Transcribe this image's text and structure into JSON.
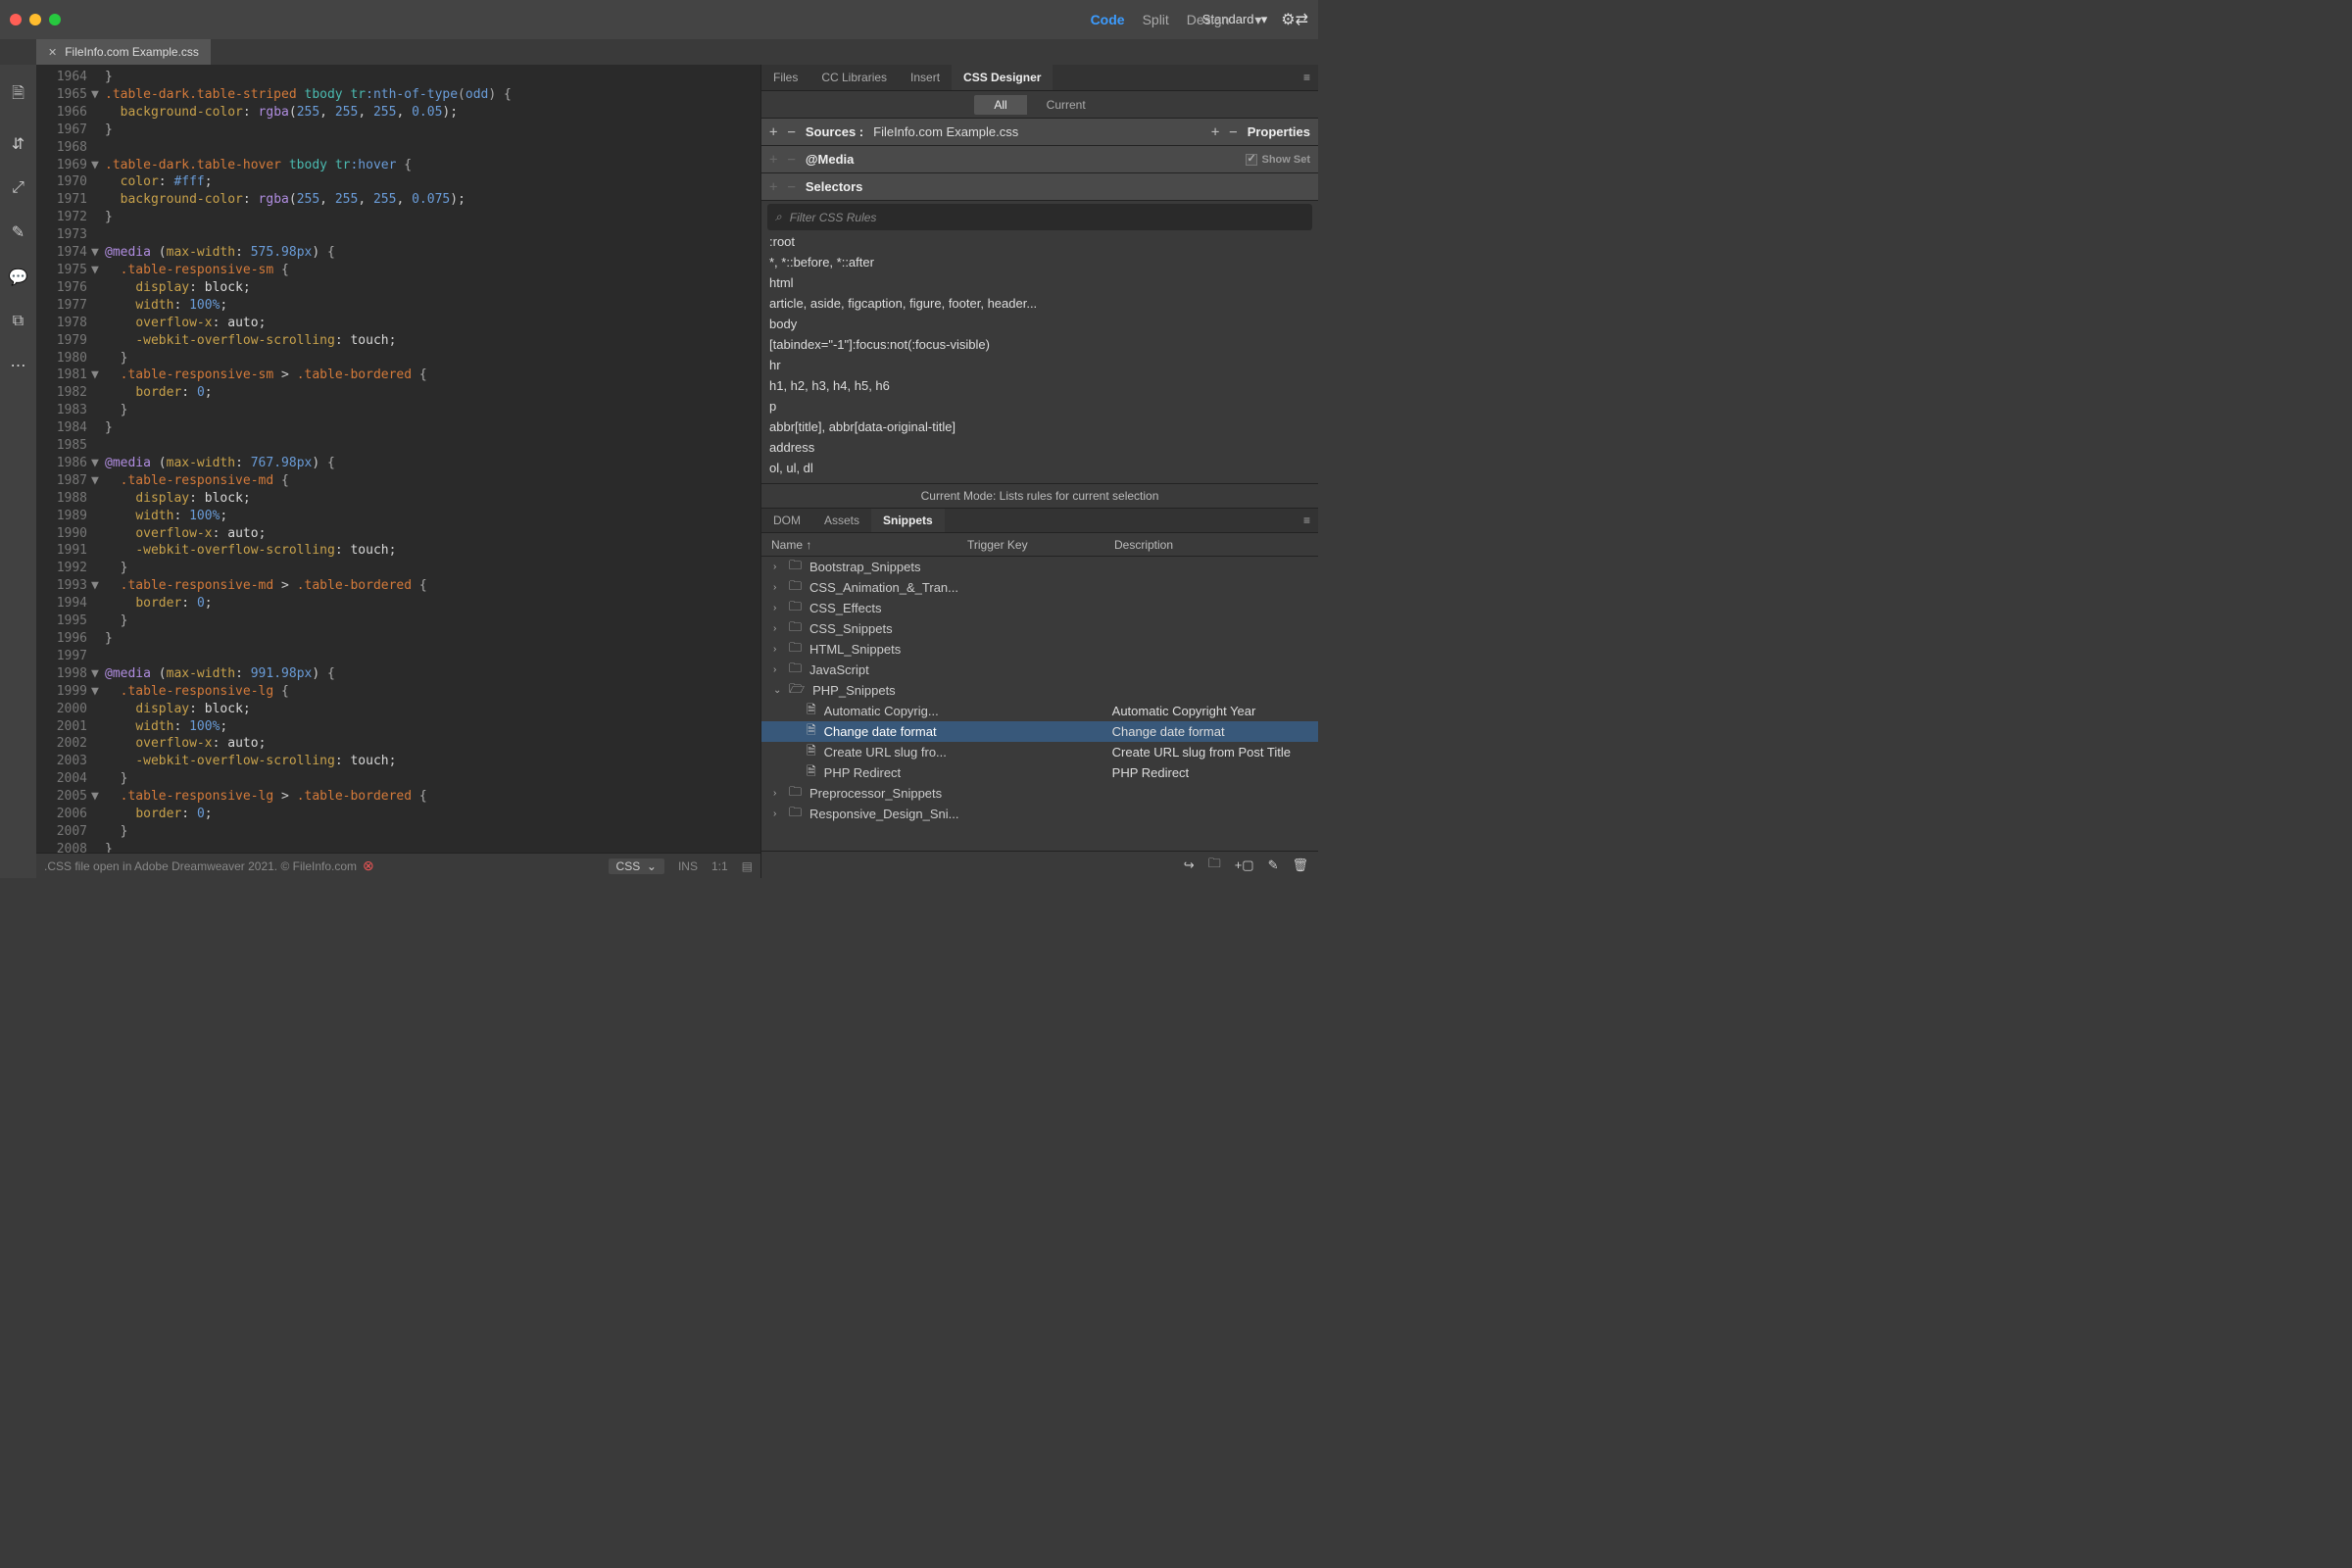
{
  "topTabs": {
    "code": "Code",
    "split": "Split",
    "design": "Design"
  },
  "workspace": "Standard",
  "fileTab": "FileInfo.com Example.css",
  "codeLines": [
    {
      "n": "1964",
      "f": "",
      "html": "<span class='tok-brace'>}</span>"
    },
    {
      "n": "1965",
      "f": "▼",
      "html": "<span class='tok-cls'>.table-dark.table-striped</span> <span class='tok-tag'>tbody</span> <span class='tok-tag'>tr</span><span class='tok-pseudo'>:nth-of-type</span><span class='tok-brace'>(</span><span class='tok-pseudo'>odd</span><span class='tok-brace'>)</span> <span class='tok-brace'>{</span>"
    },
    {
      "n": "1966",
      "f": "",
      "html": "  <span class='tok-prop'>background-color</span>: <span class='tok-func'>rgba</span>(<span class='tok-num'>255</span>, <span class='tok-num'>255</span>, <span class='tok-num'>255</span>, <span class='tok-num'>0.05</span>);"
    },
    {
      "n": "1967",
      "f": "",
      "html": "<span class='tok-brace'>}</span>"
    },
    {
      "n": "1968",
      "f": "",
      "html": ""
    },
    {
      "n": "1969",
      "f": "▼",
      "html": "<span class='tok-cls'>.table-dark.table-hover</span> <span class='tok-tag'>tbody</span> <span class='tok-tag'>tr</span><span class='tok-pseudo'>:hover</span> <span class='tok-brace'>{</span>"
    },
    {
      "n": "1970",
      "f": "",
      "html": "  <span class='tok-prop'>color</span>: <span class='tok-num'>#fff</span>;"
    },
    {
      "n": "1971",
      "f": "",
      "html": "  <span class='tok-prop'>background-color</span>: <span class='tok-func'>rgba</span>(<span class='tok-num'>255</span>, <span class='tok-num'>255</span>, <span class='tok-num'>255</span>, <span class='tok-num'>0.075</span>);"
    },
    {
      "n": "1972",
      "f": "",
      "html": "<span class='tok-brace'>}</span>"
    },
    {
      "n": "1973",
      "f": "",
      "html": ""
    },
    {
      "n": "1974",
      "f": "▼",
      "html": "<span class='tok-at'>@media</span> (<span class='tok-prop'>max-width</span>: <span class='tok-num'>575.98px</span>) <span class='tok-brace'>{</span>"
    },
    {
      "n": "1975",
      "f": "▼",
      "html": "  <span class='tok-cls'>.table-responsive-sm</span> <span class='tok-brace'>{</span>"
    },
    {
      "n": "1976",
      "f": "",
      "html": "    <span class='tok-prop'>display</span>: <span class='tok-val'>block</span>;"
    },
    {
      "n": "1977",
      "f": "",
      "html": "    <span class='tok-prop'>width</span>: <span class='tok-num'>100%</span>;"
    },
    {
      "n": "1978",
      "f": "",
      "html": "    <span class='tok-prop'>overflow-x</span>: <span class='tok-val'>auto</span>;"
    },
    {
      "n": "1979",
      "f": "",
      "html": "    <span class='tok-prop'>-webkit-overflow-scrolling</span>: <span class='tok-val'>touch</span>;"
    },
    {
      "n": "1980",
      "f": "",
      "html": "  <span class='tok-brace'>}</span>"
    },
    {
      "n": "1981",
      "f": "▼",
      "html": "  <span class='tok-cls'>.table-responsive-sm</span> > <span class='tok-cls'>.table-bordered</span> <span class='tok-brace'>{</span>"
    },
    {
      "n": "1982",
      "f": "",
      "html": "    <span class='tok-prop'>border</span>: <span class='tok-num'>0</span>;"
    },
    {
      "n": "1983",
      "f": "",
      "html": "  <span class='tok-brace'>}</span>"
    },
    {
      "n": "1984",
      "f": "",
      "html": "<span class='tok-brace'>}</span>"
    },
    {
      "n": "1985",
      "f": "",
      "html": ""
    },
    {
      "n": "1986",
      "f": "▼",
      "html": "<span class='tok-at'>@media</span> (<span class='tok-prop'>max-width</span>: <span class='tok-num'>767.98px</span>) <span class='tok-brace'>{</span>"
    },
    {
      "n": "1987",
      "f": "▼",
      "html": "  <span class='tok-cls'>.table-responsive-md</span> <span class='tok-brace'>{</span>"
    },
    {
      "n": "1988",
      "f": "",
      "html": "    <span class='tok-prop'>display</span>: <span class='tok-val'>block</span>;"
    },
    {
      "n": "1989",
      "f": "",
      "html": "    <span class='tok-prop'>width</span>: <span class='tok-num'>100%</span>;"
    },
    {
      "n": "1990",
      "f": "",
      "html": "    <span class='tok-prop'>overflow-x</span>: <span class='tok-val'>auto</span>;"
    },
    {
      "n": "1991",
      "f": "",
      "html": "    <span class='tok-prop'>-webkit-overflow-scrolling</span>: <span class='tok-val'>touch</span>;"
    },
    {
      "n": "1992",
      "f": "",
      "html": "  <span class='tok-brace'>}</span>"
    },
    {
      "n": "1993",
      "f": "▼",
      "html": "  <span class='tok-cls'>.table-responsive-md</span> > <span class='tok-cls'>.table-bordered</span> <span class='tok-brace'>{</span>"
    },
    {
      "n": "1994",
      "f": "",
      "html": "    <span class='tok-prop'>border</span>: <span class='tok-num'>0</span>;"
    },
    {
      "n": "1995",
      "f": "",
      "html": "  <span class='tok-brace'>}</span>"
    },
    {
      "n": "1996",
      "f": "",
      "html": "<span class='tok-brace'>}</span>"
    },
    {
      "n": "1997",
      "f": "",
      "html": ""
    },
    {
      "n": "1998",
      "f": "▼",
      "html": "<span class='tok-at'>@media</span> (<span class='tok-prop'>max-width</span>: <span class='tok-num'>991.98px</span>) <span class='tok-brace'>{</span>"
    },
    {
      "n": "1999",
      "f": "▼",
      "html": "  <span class='tok-cls'>.table-responsive-lg</span> <span class='tok-brace'>{</span>"
    },
    {
      "n": "2000",
      "f": "",
      "html": "    <span class='tok-prop'>display</span>: <span class='tok-val'>block</span>;"
    },
    {
      "n": "2001",
      "f": "",
      "html": "    <span class='tok-prop'>width</span>: <span class='tok-num'>100%</span>;"
    },
    {
      "n": "2002",
      "f": "",
      "html": "    <span class='tok-prop'>overflow-x</span>: <span class='tok-val'>auto</span>;"
    },
    {
      "n": "2003",
      "f": "",
      "html": "    <span class='tok-prop'>-webkit-overflow-scrolling</span>: <span class='tok-val'>touch</span>;"
    },
    {
      "n": "2004",
      "f": "",
      "html": "  <span class='tok-brace'>}</span>"
    },
    {
      "n": "2005",
      "f": "▼",
      "html": "  <span class='tok-cls'>.table-responsive-lg</span> > <span class='tok-cls'>.table-bordered</span> <span class='tok-brace'>{</span>"
    },
    {
      "n": "2006",
      "f": "",
      "html": "    <span class='tok-prop'>border</span>: <span class='tok-num'>0</span>;"
    },
    {
      "n": "2007",
      "f": "",
      "html": "  <span class='tok-brace'>}</span>"
    },
    {
      "n": "2008",
      "f": "",
      "html": "<span class='tok-brace'>}</span>"
    }
  ],
  "status": {
    "msg": ".CSS file open in Adobe Dreamweaver 2021. © FileInfo.com",
    "lang": "CSS",
    "ins": "INS",
    "pos": "1:1"
  },
  "rpanel": {
    "tabs": [
      "Files",
      "CC Libraries",
      "Insert",
      "CSS Designer"
    ],
    "all": "All",
    "current": "Current",
    "sourcesLabel": "Sources :",
    "sourcesFile": "FileInfo.com Example.css",
    "propsLabel": "Properties",
    "mediaLabel": "@Media",
    "showSet": "Show Set",
    "selectorsLabel": "Selectors",
    "filterPh": "Filter CSS Rules",
    "selectors": [
      ":root",
      "*, *::before, *::after",
      "html",
      "article, aside, figcaption, figure, footer, header...",
      "body",
      "[tabindex=\"-1\"]:focus:not(:focus-visible)",
      "hr",
      "h1, h2, h3, h4, h5, h6",
      "p",
      "abbr[title], abbr[data-original-title]",
      "address",
      "ol, ul, dl"
    ],
    "modeNote": "Current Mode: Lists rules for current selection"
  },
  "bottom": {
    "tabs": [
      "DOM",
      "Assets",
      "Snippets"
    ],
    "cols": {
      "name": "Name ↑",
      "trigger": "Trigger Key",
      "desc": "Description"
    },
    "nodes": [
      {
        "t": "folder",
        "lvl": 0,
        "arr": "›",
        "name": "Bootstrap_Snippets"
      },
      {
        "t": "folder",
        "lvl": 0,
        "arr": "›",
        "name": "CSS_Animation_&_Tran..."
      },
      {
        "t": "folder",
        "lvl": 0,
        "arr": "›",
        "name": "CSS_Effects"
      },
      {
        "t": "folder",
        "lvl": 0,
        "arr": "›",
        "name": "CSS_Snippets"
      },
      {
        "t": "folder",
        "lvl": 0,
        "arr": "›",
        "name": "HTML_Snippets"
      },
      {
        "t": "folder",
        "lvl": 0,
        "arr": "›",
        "name": "JavaScript"
      },
      {
        "t": "folder",
        "lvl": 0,
        "arr": "⌄",
        "name": "PHP_Snippets",
        "open": true
      },
      {
        "t": "file",
        "lvl": 1,
        "name": "Automatic Copyrig...",
        "desc": "Automatic Copyright Year"
      },
      {
        "t": "file",
        "lvl": 1,
        "name": "Change date format",
        "desc": "Change date format",
        "sel": true
      },
      {
        "t": "file",
        "lvl": 1,
        "name": "Create URL slug fro...",
        "desc": "Create URL slug from Post Title"
      },
      {
        "t": "file",
        "lvl": 1,
        "name": "PHP Redirect",
        "desc": "PHP Redirect"
      },
      {
        "t": "folder",
        "lvl": 0,
        "arr": "›",
        "name": "Preprocessor_Snippets"
      },
      {
        "t": "folder",
        "lvl": 0,
        "arr": "›",
        "name": "Responsive_Design_Sni..."
      }
    ]
  }
}
